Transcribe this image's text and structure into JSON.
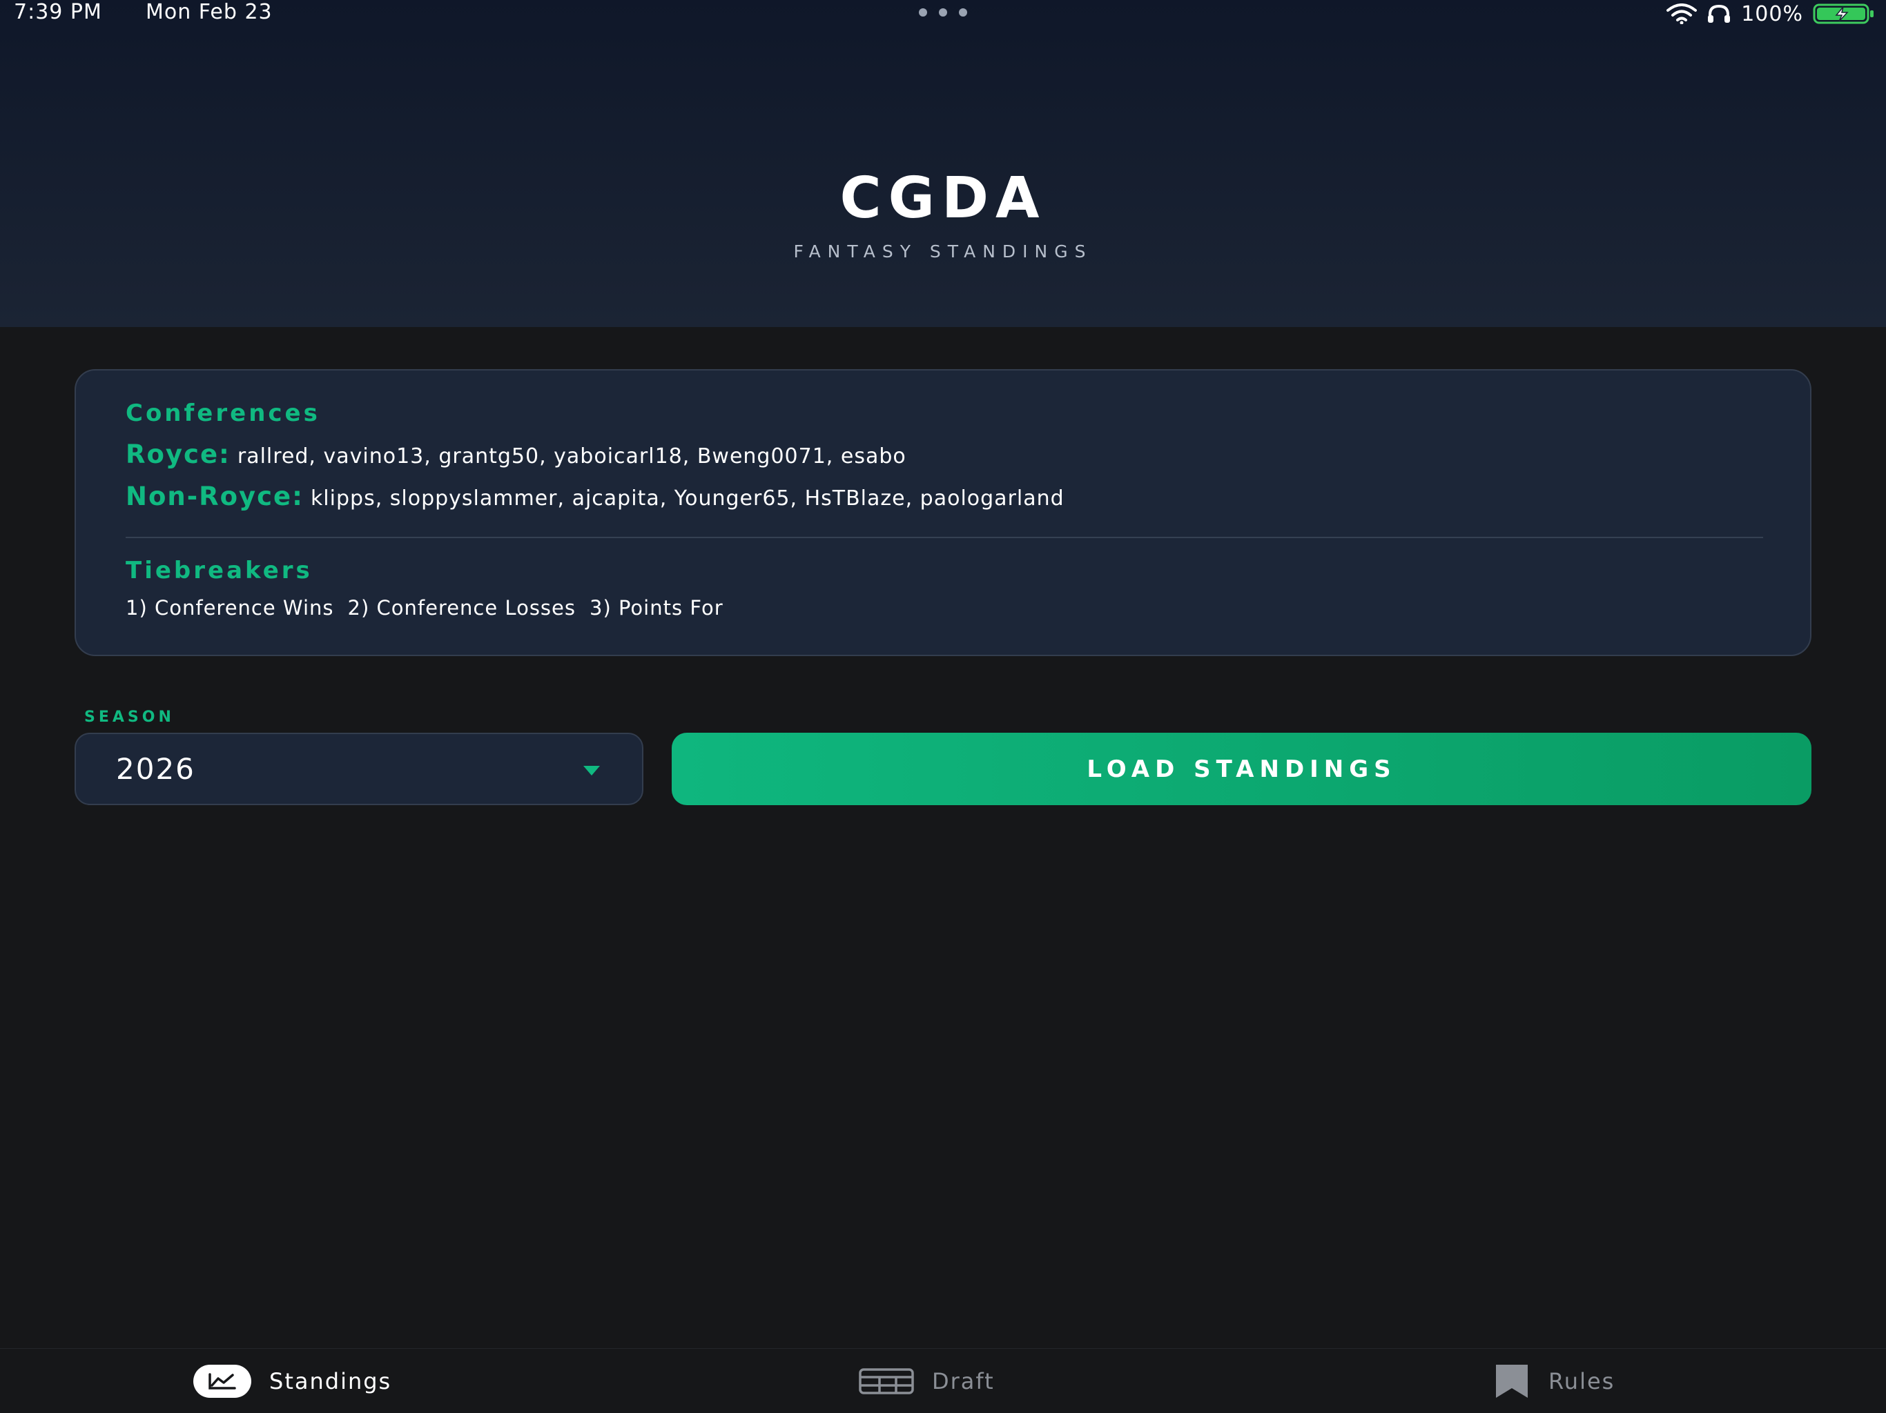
{
  "status_bar": {
    "time": "7:39 PM",
    "date": "Mon Feb 23",
    "battery_pct": "100%",
    "icons": [
      "more-dots-icon",
      "wifi-icon",
      "headphones-icon",
      "battery-charging-icon"
    ]
  },
  "header": {
    "title": "CGDA",
    "subtitle": "FANTASY STANDINGS"
  },
  "info_card": {
    "conferences_heading": "Conferences",
    "conferences": [
      {
        "label": "Royce:",
        "members": "rallred, vavino13, grantg50, yaboicarl18, Bweng0071, esabo"
      },
      {
        "label": "Non-Royce:",
        "members": "klipps, sloppyslammer, ajcapita, Younger65, HsTBlaze, paologarland"
      }
    ],
    "tiebreakers_heading": "Tiebreakers",
    "tiebreakers": [
      "1) Conference Wins",
      "2) Conference Losses",
      "3) Points For"
    ]
  },
  "season": {
    "label": "SEASON",
    "selected": "2026"
  },
  "load_button": {
    "label": "LOAD STANDINGS"
  },
  "tabs": [
    {
      "label": "Standings",
      "icon": "chart-icon",
      "active": true
    },
    {
      "label": "Draft",
      "icon": "table-icon",
      "active": false
    },
    {
      "label": "Rules",
      "icon": "bookmark-icon",
      "active": false
    }
  ],
  "colors": {
    "accent": "#10b981",
    "background": "#161719",
    "card": "#1c2638",
    "header_top": "#0f1729",
    "inactive_tab": "#8b8f96"
  }
}
